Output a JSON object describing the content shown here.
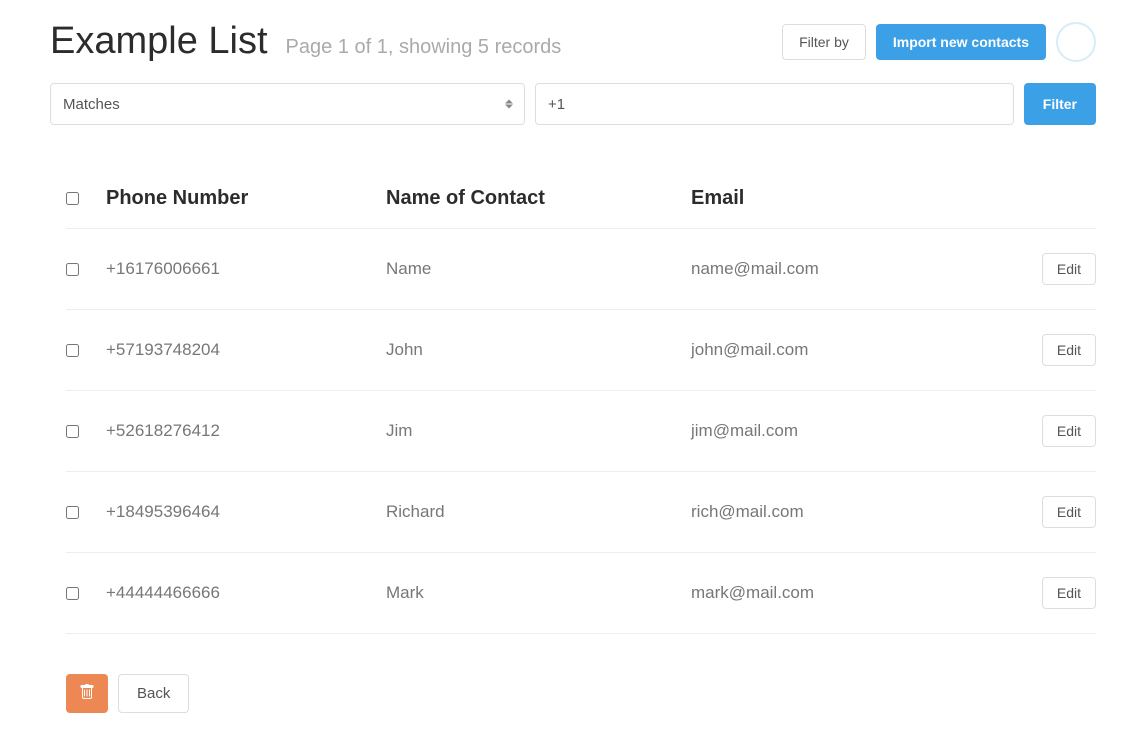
{
  "header": {
    "title": "Example List",
    "subtitle": "Page 1 of 1, showing 5 records",
    "filter_by_label": "Filter by",
    "import_label": "Import new contacts"
  },
  "filter": {
    "match_select_value": "Matches",
    "search_value": "+1",
    "filter_button_label": "Filter"
  },
  "table": {
    "columns": {
      "phone": "Phone Number",
      "name": "Name of Contact",
      "email": "Email"
    },
    "edit_label": "Edit",
    "rows": [
      {
        "phone": "+16176006661",
        "name": "Name",
        "email": "name@mail.com"
      },
      {
        "phone": "+57193748204",
        "name": "John",
        "email": "john@mail.com"
      },
      {
        "phone": "+52618276412",
        "name": "Jim",
        "email": "jim@mail.com"
      },
      {
        "phone": "+18495396464",
        "name": "Richard",
        "email": "rich@mail.com"
      },
      {
        "phone": "+44444466666",
        "name": "Mark",
        "email": "mark@mail.com"
      }
    ]
  },
  "footer": {
    "back_label": "Back"
  }
}
